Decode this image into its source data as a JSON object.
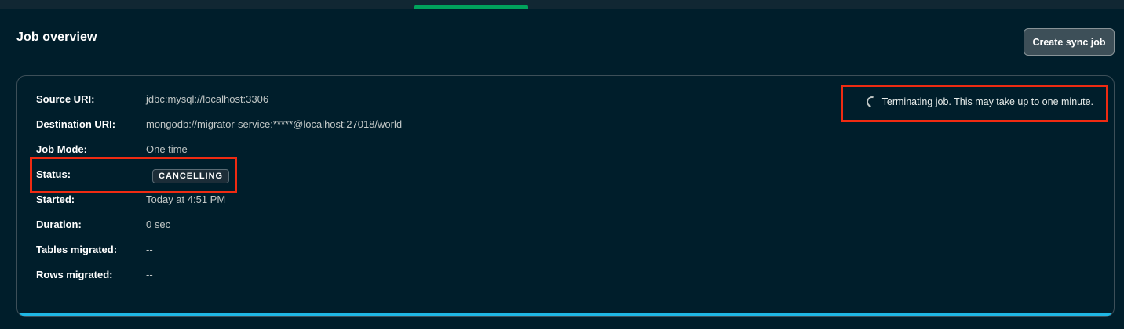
{
  "header": {
    "title": "Job overview",
    "create_button_label": "Create sync job"
  },
  "job": {
    "fields": [
      {
        "label": "Source URI:",
        "value": "jdbc:mysql://localhost:3306"
      },
      {
        "label": "Destination URI:",
        "value": "mongodb://migrator-service:*****@localhost:27018/world"
      },
      {
        "label": "Job Mode:",
        "value": "One time"
      },
      {
        "label": "Status:",
        "value": "CANCELLING"
      },
      {
        "label": "Started:",
        "value": "Today at 4:51 PM"
      },
      {
        "label": "Duration:",
        "value": "0 sec"
      },
      {
        "label": "Tables migrated:",
        "value": "--"
      },
      {
        "label": "Rows migrated:",
        "value": "--"
      }
    ],
    "status_message": "Terminating job. This may take up to one minute.",
    "status_icon": "loading-spinner-icon",
    "progress_fraction": 1.0
  },
  "colors": {
    "background": "#001e2b",
    "accent_green": "#00a35c",
    "progress_blue": "#1fb8e6",
    "highlight_red": "#ef2b12"
  }
}
